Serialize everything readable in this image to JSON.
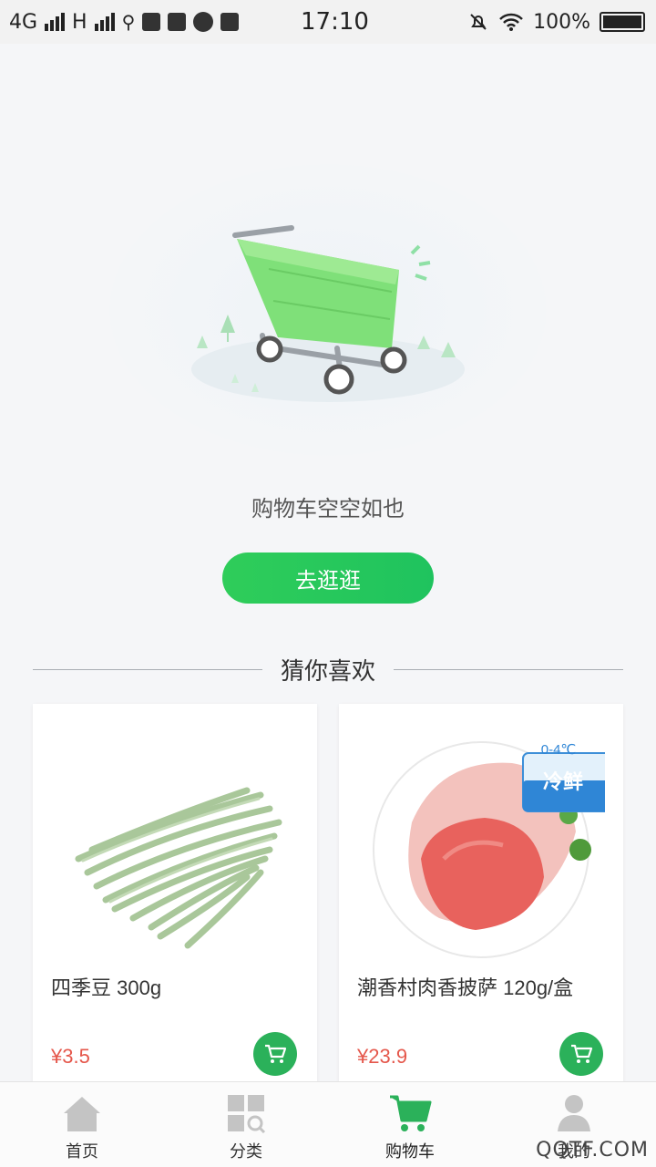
{
  "status_bar": {
    "network_1": "4G",
    "network_2": "H",
    "time": "17:10",
    "battery": "100%"
  },
  "empty_cart": {
    "message": "购物车空空如也",
    "button_label": "去逛逛"
  },
  "recommend": {
    "title": "猜你喜欢",
    "products": [
      {
        "name": "四季豆 300g",
        "price": "¥3.5"
      },
      {
        "name": "潮香村肉香披萨 120g/盒",
        "price": "¥23.9",
        "badge_temp": "0-4℃",
        "badge_label": "冷鲜"
      }
    ]
  },
  "tabbar": {
    "items": [
      {
        "label": "首页",
        "icon": "home-icon"
      },
      {
        "label": "分类",
        "icon": "category-icon"
      },
      {
        "label": "购物车",
        "icon": "cart-icon",
        "active": true
      },
      {
        "label": "我的",
        "icon": "user-icon"
      }
    ]
  },
  "watermark": "QQTF.COM",
  "colors": {
    "accent": "#2bb15a",
    "price": "#e5574b",
    "button_gradient_start": "#2fcd5a",
    "button_gradient_end": "#1fc35e"
  }
}
